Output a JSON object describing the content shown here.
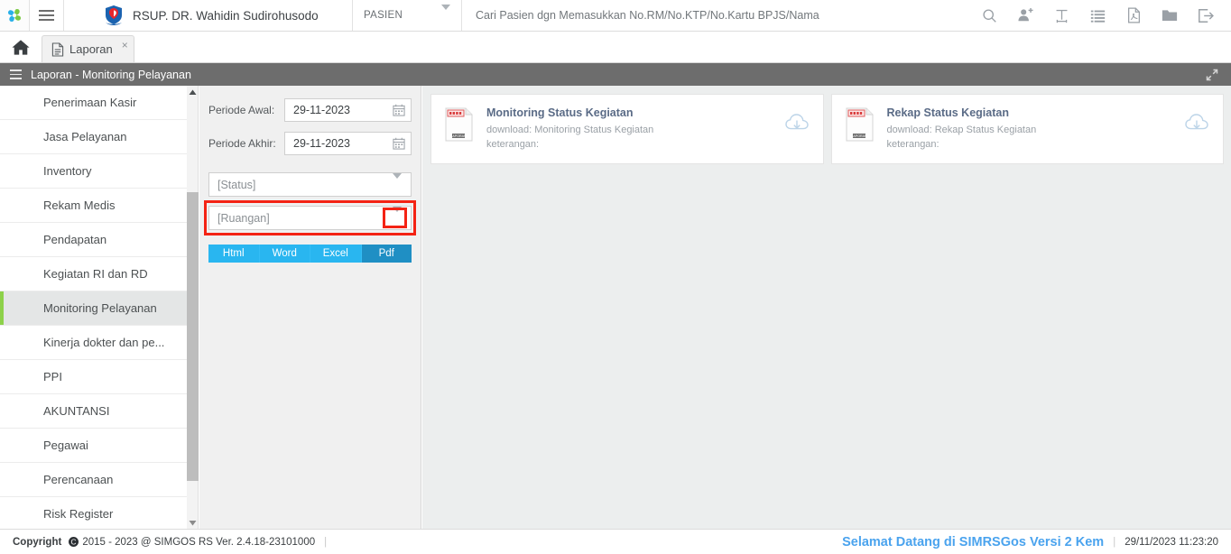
{
  "header": {
    "logo_icon": "simgos-pinwheel-logo",
    "menu_icon": "hamburger-icon",
    "hospital_logo_icon": "hospital-shield-logo",
    "hospital_name": "RSUP. DR. Wahidin Sudirohusodo",
    "search_scope": "PASIEN",
    "search_placeholder": "Cari Pasien dgn Memasukkan No.RM/No.KTP/No.Kartu BPJS/Nama",
    "search_value": "",
    "icons": [
      {
        "name": "search-icon",
        "title": "Cari"
      },
      {
        "name": "add-user-icon",
        "title": "Tambah Pasien"
      },
      {
        "name": "text-tool-icon",
        "title": "Teks"
      },
      {
        "name": "list-icon",
        "title": "Daftar"
      },
      {
        "name": "pdf-icon",
        "title": "PDF"
      },
      {
        "name": "folder-icon",
        "title": "Folder"
      },
      {
        "name": "logout-icon",
        "title": "Keluar"
      }
    ]
  },
  "tabs": {
    "home_icon": "home-icon",
    "items": [
      {
        "label": "Laporan",
        "icon": "document-icon",
        "close": "×",
        "active": true
      }
    ]
  },
  "pagebar": {
    "menu_icon": "hamburger-icon",
    "title": "Laporan - Monitoring Pelayanan",
    "expand_icon": "expand-diagonal-icon"
  },
  "sidebar": {
    "items": [
      {
        "label": "Penerimaan Kasir",
        "active": false
      },
      {
        "label": "Jasa Pelayanan",
        "active": false
      },
      {
        "label": "Inventory",
        "active": false
      },
      {
        "label": "Rekam Medis",
        "active": false
      },
      {
        "label": "Pendapatan",
        "active": false
      },
      {
        "label": "Kegiatan RI dan RD",
        "active": false
      },
      {
        "label": "Monitoring Pelayanan",
        "active": true
      },
      {
        "label": "Kinerja dokter dan pe...",
        "active": false
      },
      {
        "label": "PPI",
        "active": false
      },
      {
        "label": "AKUNTANSI",
        "active": false
      },
      {
        "label": "Pegawai",
        "active": false
      },
      {
        "label": "Perencanaan",
        "active": false
      },
      {
        "label": "Risk Register",
        "active": false
      }
    ],
    "scroll_up_icon": "triangle-up-icon",
    "scroll_down_icon": "triangle-down-icon"
  },
  "form": {
    "periode_awal_label": "Periode Awal:",
    "periode_awal_value": "29-11-2023",
    "periode_akhir_label": "Periode Akhir:",
    "periode_akhir_value": "29-11-2023",
    "calendar_icon": "calendar-icon",
    "status_select": "[Status]",
    "ruangan_select": "[Ruangan]",
    "dropdown_icon": "caret-down-icon",
    "highlight_color": "#f42314",
    "formats": [
      {
        "label": "Html",
        "active": false
      },
      {
        "label": "Word",
        "active": false
      },
      {
        "label": "Excel",
        "active": false
      },
      {
        "label": "Pdf",
        "active": true
      }
    ]
  },
  "content": {
    "cards": [
      {
        "title": "Monitoring Status Kegiatan",
        "download_line": "download: Monitoring Status Kegiatan",
        "keterangan_line": "keterangan:",
        "doc_icon": "report-document-icon",
        "doc_icon_label": "LAPORAN",
        "download_icon": "cloud-download-icon"
      },
      {
        "title": "Rekap Status Kegiatan",
        "download_line": "download: Rekap Status Kegiatan",
        "keterangan_line": "keterangan:",
        "doc_icon": "report-document-icon",
        "doc_icon_label": "LAPORAN",
        "download_icon": "cloud-download-icon"
      }
    ]
  },
  "footer": {
    "copyright_label": "Copyright",
    "copyright_icon": "copyright-icon",
    "copyright_text": "2015 - 2023 @ SIMGOS RS Ver. 2.4.18-23101000",
    "separator": "|",
    "welcome": "Selamat Datang di SIMRSGos Versi 2 Kem",
    "datetime": "29/11/2023 11:23:20"
  },
  "colors": {
    "accent_blue": "#29b6f0",
    "accent_blue_dark": "#1f8fc4",
    "active_green": "#8dd14a",
    "pagebar_gray": "#6d6d6d",
    "welcome_blue": "#4aa3ee"
  }
}
